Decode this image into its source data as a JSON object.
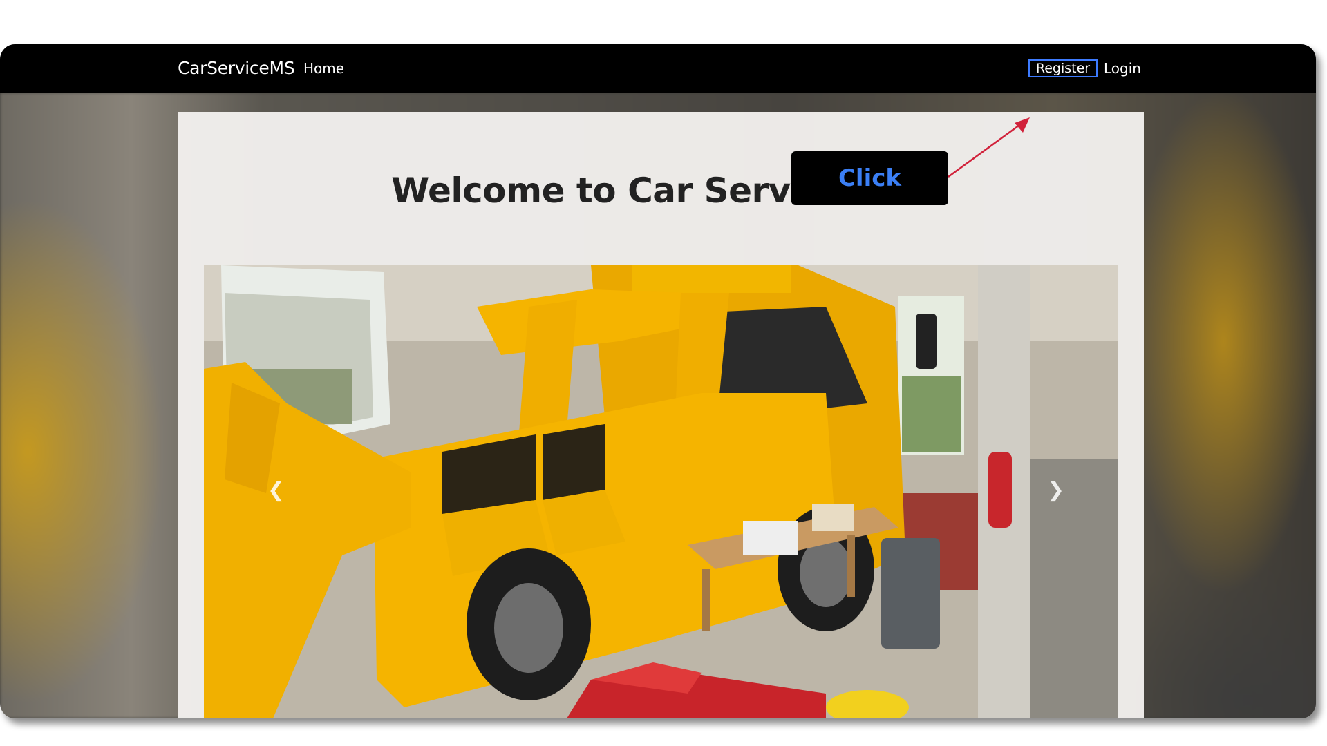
{
  "navbar": {
    "brand": "CarServiceMS",
    "home": "Home",
    "register": "Register",
    "login": "Login"
  },
  "main": {
    "title": "Welcome to Car Service MS!",
    "carousel": {
      "image": "tow-truck-in-garage",
      "prev_icon": "chevron-left-icon",
      "next_icon": "chevron-right-icon"
    }
  },
  "annotation": {
    "callout_text": "Click",
    "callout_color": "#3b7ff5",
    "arrow_color": "#d1213a"
  },
  "colors": {
    "navbar_bg": "#000000",
    "register_border": "#3d7bff",
    "truck_yellow": "#f5b400"
  }
}
